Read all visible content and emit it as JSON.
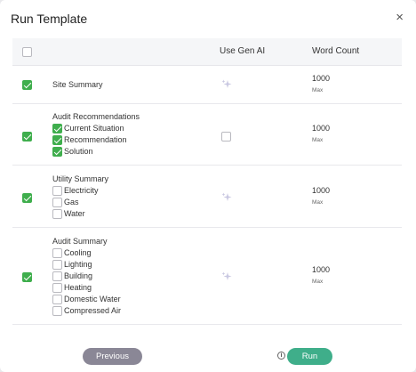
{
  "modal": {
    "title": "Run Template",
    "close_glyph": "×"
  },
  "table": {
    "headers": {
      "use_gen_ai": "Use Gen AI",
      "word_count": "Word Count"
    },
    "rows": [
      {
        "label": "Site Summary",
        "checked": true,
        "gen_ai": "sparkle-icon",
        "word_count": "1000",
        "max_label": "Max",
        "sub_items": []
      },
      {
        "label": "Audit Recommendations",
        "checked": true,
        "gen_ai": "checkbox",
        "gen_ai_checked": false,
        "word_count": "1000",
        "max_label": "Max",
        "sub_items": [
          {
            "label": "Current Situation",
            "checked": true
          },
          {
            "label": "Recommendation",
            "checked": true
          },
          {
            "label": "Solution",
            "checked": true
          }
        ]
      },
      {
        "label": "Utility Summary",
        "checked": true,
        "gen_ai": "sparkle-icon",
        "word_count": "1000",
        "max_label": "Max",
        "sub_items": [
          {
            "label": "Electricity",
            "checked": false
          },
          {
            "label": "Gas",
            "checked": false
          },
          {
            "label": "Water",
            "checked": false
          }
        ]
      },
      {
        "label": "Audit Summary",
        "checked": true,
        "gen_ai": "sparkle-icon",
        "word_count": "1000",
        "max_label": "Max",
        "sub_items": [
          {
            "label": "Cooling",
            "checked": false
          },
          {
            "label": "Lighting",
            "checked": false
          },
          {
            "label": "Building",
            "checked": false
          },
          {
            "label": "Heating",
            "checked": false
          },
          {
            "label": "Domestic Water",
            "checked": false
          },
          {
            "label": "Compressed Air",
            "checked": false
          }
        ]
      }
    ]
  },
  "footer": {
    "previous_label": "Previous",
    "run_label": "Run",
    "info_glyph": "i"
  },
  "colors": {
    "check_green": "#3fae4d",
    "run_button": "#3fae8a",
    "previous_button": "#8a8796",
    "sparkle": "#c9c8e2"
  }
}
